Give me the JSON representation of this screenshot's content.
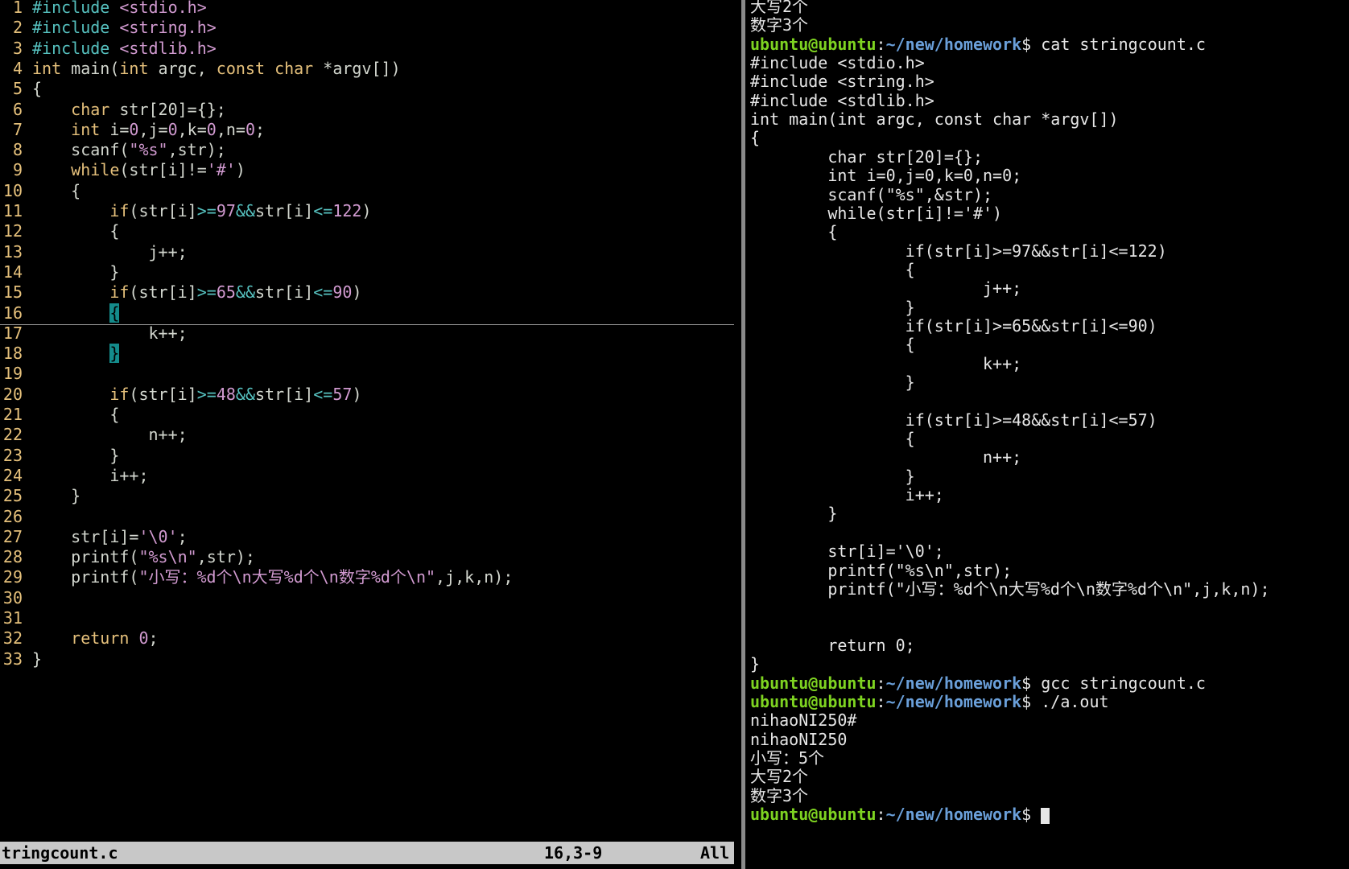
{
  "vim": {
    "lines": [
      {
        "n": "1",
        "tokens": [
          {
            "t": "#include ",
            "c": "ty"
          },
          {
            "t": "<stdio.h>",
            "c": "st"
          }
        ]
      },
      {
        "n": "2",
        "tokens": [
          {
            "t": "#include ",
            "c": "ty"
          },
          {
            "t": "<string.h>",
            "c": "st"
          }
        ]
      },
      {
        "n": "3",
        "tokens": [
          {
            "t": "#include ",
            "c": "ty"
          },
          {
            "t": "<stdlib.h>",
            "c": "st"
          }
        ]
      },
      {
        "n": "4",
        "tokens": [
          {
            "t": "int",
            "c": "kw"
          },
          {
            "t": " main(",
            "c": ""
          },
          {
            "t": "int",
            "c": "kw"
          },
          {
            "t": " argc, ",
            "c": ""
          },
          {
            "t": "const",
            "c": "kw"
          },
          {
            "t": " ",
            "c": ""
          },
          {
            "t": "char",
            "c": "kw"
          },
          {
            "t": " *argv[])",
            "c": ""
          }
        ]
      },
      {
        "n": "5",
        "tokens": [
          {
            "t": "{",
            "c": ""
          }
        ]
      },
      {
        "n": "6",
        "tokens": [
          {
            "t": "    ",
            "c": ""
          },
          {
            "t": "char",
            "c": "kw"
          },
          {
            "t": " str[20]={};",
            "c": ""
          }
        ]
      },
      {
        "n": "7",
        "tokens": [
          {
            "t": "    ",
            "c": ""
          },
          {
            "t": "int",
            "c": "kw"
          },
          {
            "t": " i=",
            "c": ""
          },
          {
            "t": "0",
            "c": "nu"
          },
          {
            "t": ",j=",
            "c": ""
          },
          {
            "t": "0",
            "c": "nu"
          },
          {
            "t": ",k=",
            "c": ""
          },
          {
            "t": "0",
            "c": "nu"
          },
          {
            "t": ",n=",
            "c": ""
          },
          {
            "t": "0",
            "c": "nu"
          },
          {
            "t": ";",
            "c": ""
          }
        ]
      },
      {
        "n": "8",
        "tokens": [
          {
            "t": "    scanf(",
            "c": ""
          },
          {
            "t": "\"%s\"",
            "c": "st"
          },
          {
            "t": ",str);",
            "c": ""
          }
        ]
      },
      {
        "n": "9",
        "tokens": [
          {
            "t": "    ",
            "c": ""
          },
          {
            "t": "while",
            "c": "kw"
          },
          {
            "t": "(str[i]!=",
            "c": ""
          },
          {
            "t": "'#'",
            "c": "st"
          },
          {
            "t": ")",
            "c": ""
          }
        ]
      },
      {
        "n": "10",
        "tokens": [
          {
            "t": "    {",
            "c": ""
          }
        ]
      },
      {
        "n": "11",
        "tokens": [
          {
            "t": "        ",
            "c": ""
          },
          {
            "t": "if",
            "c": "kw"
          },
          {
            "t": "(str[i]",
            "c": ""
          },
          {
            "t": ">=",
            "c": "op"
          },
          {
            "t": "97",
            "c": "nu"
          },
          {
            "t": "&&",
            "c": "op"
          },
          {
            "t": "str[i]",
            "c": ""
          },
          {
            "t": "<=",
            "c": "op"
          },
          {
            "t": "122",
            "c": "nu"
          },
          {
            "t": ")",
            "c": ""
          }
        ]
      },
      {
        "n": "12",
        "tokens": [
          {
            "t": "        {",
            "c": ""
          }
        ]
      },
      {
        "n": "13",
        "tokens": [
          {
            "t": "            j++;",
            "c": ""
          }
        ]
      },
      {
        "n": "14",
        "tokens": [
          {
            "t": "        }",
            "c": ""
          }
        ]
      },
      {
        "n": "15",
        "tokens": [
          {
            "t": "        ",
            "c": ""
          },
          {
            "t": "if",
            "c": "kw"
          },
          {
            "t": "(str[i]",
            "c": ""
          },
          {
            "t": ">=",
            "c": "op"
          },
          {
            "t": "65",
            "c": "nu"
          },
          {
            "t": "&&",
            "c": "op"
          },
          {
            "t": "str[i]",
            "c": ""
          },
          {
            "t": "<=",
            "c": "op"
          },
          {
            "t": "90",
            "c": "nu"
          },
          {
            "t": ")",
            "c": ""
          }
        ]
      },
      {
        "n": "16",
        "tokens": [
          {
            "t": "        ",
            "c": ""
          },
          {
            "t": "{",
            "c": "hlb"
          }
        ]
      },
      {
        "n": "17",
        "tokens": [
          {
            "t": "            k++;",
            "c": ""
          }
        ]
      },
      {
        "n": "18",
        "tokens": [
          {
            "t": "        ",
            "c": ""
          },
          {
            "t": "}",
            "c": "hlb"
          }
        ]
      },
      {
        "n": "19",
        "tokens": []
      },
      {
        "n": "20",
        "tokens": [
          {
            "t": "        ",
            "c": ""
          },
          {
            "t": "if",
            "c": "kw"
          },
          {
            "t": "(str[i]",
            "c": ""
          },
          {
            "t": ">=",
            "c": "op"
          },
          {
            "t": "48",
            "c": "nu"
          },
          {
            "t": "&&",
            "c": "op"
          },
          {
            "t": "str[i]",
            "c": ""
          },
          {
            "t": "<=",
            "c": "op"
          },
          {
            "t": "57",
            "c": "nu"
          },
          {
            "t": ")",
            "c": ""
          }
        ]
      },
      {
        "n": "21",
        "tokens": [
          {
            "t": "        {",
            "c": ""
          }
        ]
      },
      {
        "n": "22",
        "tokens": [
          {
            "t": "            n++;",
            "c": ""
          }
        ]
      },
      {
        "n": "23",
        "tokens": [
          {
            "t": "        }",
            "c": ""
          }
        ]
      },
      {
        "n": "24",
        "tokens": [
          {
            "t": "        i++;",
            "c": ""
          }
        ]
      },
      {
        "n": "25",
        "tokens": [
          {
            "t": "    }",
            "c": ""
          }
        ]
      },
      {
        "n": "26",
        "tokens": []
      },
      {
        "n": "27",
        "tokens": [
          {
            "t": "    str[i]=",
            "c": ""
          },
          {
            "t": "'\\0'",
            "c": "st"
          },
          {
            "t": ";",
            "c": ""
          }
        ]
      },
      {
        "n": "28",
        "tokens": [
          {
            "t": "    printf(",
            "c": ""
          },
          {
            "t": "\"%s\\n\"",
            "c": "st"
          },
          {
            "t": ",str);",
            "c": ""
          }
        ]
      },
      {
        "n": "29",
        "tokens": [
          {
            "t": "    printf(",
            "c": ""
          },
          {
            "t": "\"小写：%d个\\n大写%d个\\n数字%d个\\n\"",
            "c": "st"
          },
          {
            "t": ",j,k,n);",
            "c": ""
          }
        ]
      },
      {
        "n": "30",
        "tokens": []
      },
      {
        "n": "31",
        "tokens": []
      },
      {
        "n": "32",
        "tokens": [
          {
            "t": "    ",
            "c": ""
          },
          {
            "t": "return",
            "c": "kw"
          },
          {
            "t": " ",
            "c": ""
          },
          {
            "t": "0",
            "c": "nu"
          },
          {
            "t": ";",
            "c": ""
          }
        ]
      },
      {
        "n": "33",
        "tokens": [
          {
            "t": "}",
            "c": ""
          }
        ]
      }
    ],
    "cursor_line": "16",
    "status": {
      "filename": "tringcount.c",
      "position": "16,3-9",
      "percent": "All"
    }
  },
  "terminal": {
    "lines": [
      {
        "parts": [
          {
            "t": "大写2个",
            "c": ""
          }
        ]
      },
      {
        "parts": [
          {
            "t": "数字3个",
            "c": ""
          }
        ]
      },
      {
        "parts": [
          {
            "t": "ubuntu@ubuntu",
            "c": "pu"
          },
          {
            "t": ":",
            "c": ""
          },
          {
            "t": "~/new/homework",
            "c": "pp"
          },
          {
            "t": "$ cat stringcount.c",
            "c": ""
          }
        ]
      },
      {
        "parts": [
          {
            "t": "#include <stdio.h>",
            "c": ""
          }
        ]
      },
      {
        "parts": [
          {
            "t": "#include <string.h>",
            "c": ""
          }
        ]
      },
      {
        "parts": [
          {
            "t": "#include <stdlib.h>",
            "c": ""
          }
        ]
      },
      {
        "parts": [
          {
            "t": "int main(int argc, const char *argv[])",
            "c": ""
          }
        ]
      },
      {
        "parts": [
          {
            "t": "{",
            "c": ""
          }
        ]
      },
      {
        "parts": [
          {
            "t": "        char str[20]={};",
            "c": ""
          }
        ]
      },
      {
        "parts": [
          {
            "t": "        int i=0,j=0,k=0,n=0;",
            "c": ""
          }
        ]
      },
      {
        "parts": [
          {
            "t": "        scanf(\"%s\",&str);",
            "c": ""
          }
        ]
      },
      {
        "parts": [
          {
            "t": "        while(str[i]!='#')",
            "c": ""
          }
        ]
      },
      {
        "parts": [
          {
            "t": "        {",
            "c": ""
          }
        ]
      },
      {
        "parts": [
          {
            "t": "                if(str[i]>=97&&str[i]<=122)",
            "c": ""
          }
        ]
      },
      {
        "parts": [
          {
            "t": "                {",
            "c": ""
          }
        ]
      },
      {
        "parts": [
          {
            "t": "                        j++;",
            "c": ""
          }
        ]
      },
      {
        "parts": [
          {
            "t": "                }",
            "c": ""
          }
        ]
      },
      {
        "parts": [
          {
            "t": "                if(str[i]>=65&&str[i]<=90)",
            "c": ""
          }
        ]
      },
      {
        "parts": [
          {
            "t": "                {",
            "c": ""
          }
        ]
      },
      {
        "parts": [
          {
            "t": "                        k++;",
            "c": ""
          }
        ]
      },
      {
        "parts": [
          {
            "t": "                }",
            "c": ""
          }
        ]
      },
      {
        "parts": []
      },
      {
        "parts": [
          {
            "t": "                if(str[i]>=48&&str[i]<=57)",
            "c": ""
          }
        ]
      },
      {
        "parts": [
          {
            "t": "                {",
            "c": ""
          }
        ]
      },
      {
        "parts": [
          {
            "t": "                        n++;",
            "c": ""
          }
        ]
      },
      {
        "parts": [
          {
            "t": "                }",
            "c": ""
          }
        ]
      },
      {
        "parts": [
          {
            "t": "                i++;",
            "c": ""
          }
        ]
      },
      {
        "parts": [
          {
            "t": "        }",
            "c": ""
          }
        ]
      },
      {
        "parts": []
      },
      {
        "parts": [
          {
            "t": "        str[i]='\\0';",
            "c": ""
          }
        ]
      },
      {
        "parts": [
          {
            "t": "        printf(\"%s\\n\",str);",
            "c": ""
          }
        ]
      },
      {
        "parts": [
          {
            "t": "        printf(\"小写：%d个\\n大写%d个\\n数字%d个\\n\",j,k,n);",
            "c": ""
          }
        ]
      },
      {
        "parts": []
      },
      {
        "parts": []
      },
      {
        "parts": [
          {
            "t": "        return 0;",
            "c": ""
          }
        ]
      },
      {
        "parts": [
          {
            "t": "}",
            "c": ""
          }
        ]
      },
      {
        "parts": [
          {
            "t": "ubuntu@ubuntu",
            "c": "pu"
          },
          {
            "t": ":",
            "c": ""
          },
          {
            "t": "~/new/homework",
            "c": "pp"
          },
          {
            "t": "$ gcc stringcount.c",
            "c": ""
          }
        ]
      },
      {
        "parts": [
          {
            "t": "ubuntu@ubuntu",
            "c": "pu"
          },
          {
            "t": ":",
            "c": ""
          },
          {
            "t": "~/new/homework",
            "c": "pp"
          },
          {
            "t": "$ ./a.out",
            "c": ""
          }
        ]
      },
      {
        "parts": [
          {
            "t": "nihaoNI250#",
            "c": ""
          }
        ]
      },
      {
        "parts": [
          {
            "t": "nihaoNI250",
            "c": ""
          }
        ]
      },
      {
        "parts": [
          {
            "t": "小写：5个",
            "c": ""
          }
        ]
      },
      {
        "parts": [
          {
            "t": "大写2个",
            "c": ""
          }
        ]
      },
      {
        "parts": [
          {
            "t": "数字3个",
            "c": ""
          }
        ]
      },
      {
        "parts": [
          {
            "t": "ubuntu@ubuntu",
            "c": "pu"
          },
          {
            "t": ":",
            "c": ""
          },
          {
            "t": "~/new/homework",
            "c": "pp"
          },
          {
            "t": "$ ",
            "c": ""
          }
        ],
        "cursor": true
      }
    ]
  },
  "colors": {
    "prompt_user": "#7ed321",
    "prompt_path": "#6a9fd9",
    "keyword": "#e5c07b",
    "string": "#d19ad0",
    "match_highlight": "#148c8c"
  }
}
